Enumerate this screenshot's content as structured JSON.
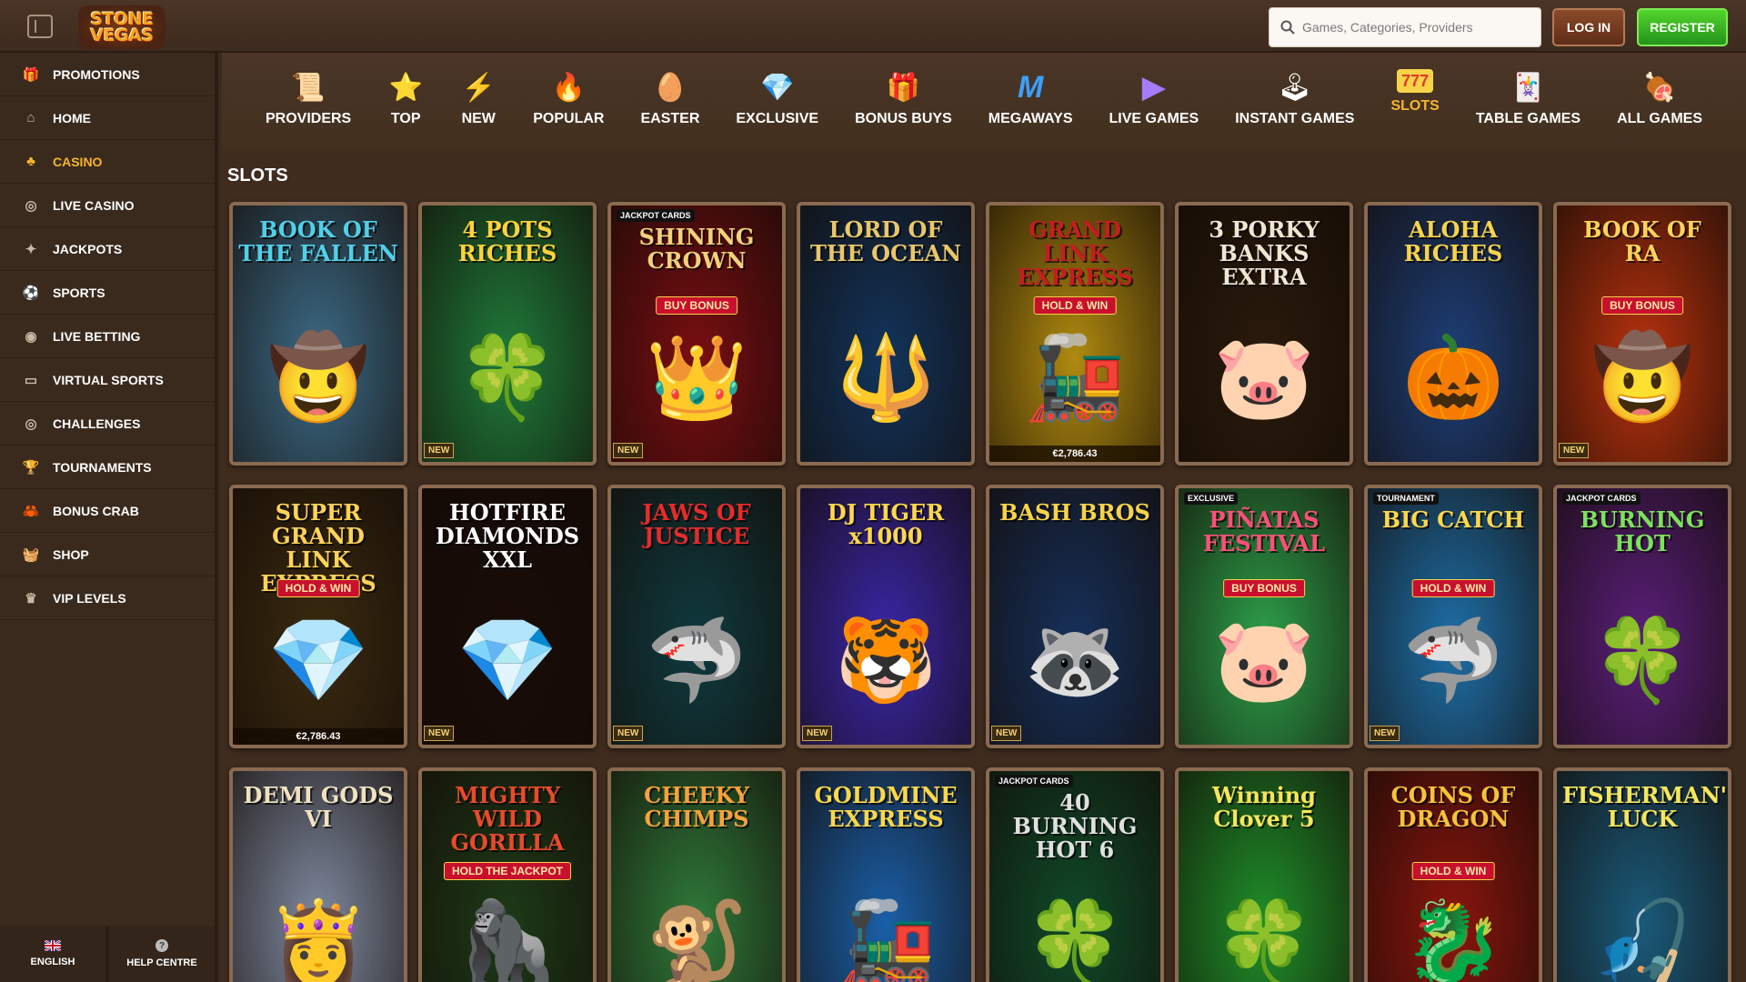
{
  "header": {
    "logo_line1": "STONE",
    "logo_line2": "VEGAS",
    "search_placeholder": "Games, Categories, Providers",
    "login_label": "LOG IN",
    "register_label": "REGISTER"
  },
  "sidebar": {
    "items": [
      {
        "label": "PROMOTIONS",
        "icon": "gift-box-icon"
      },
      {
        "label": "HOME",
        "icon": "home-icon"
      },
      {
        "label": "CASINO",
        "icon": "casino-icon",
        "active": true
      },
      {
        "label": "LIVE CASINO",
        "icon": "chip-icon"
      },
      {
        "label": "JACKPOTS",
        "icon": "jackpot-icon"
      },
      {
        "label": "SPORTS",
        "icon": "ball-icon"
      },
      {
        "label": "LIVE BETTING",
        "icon": "live-betting-icon"
      },
      {
        "label": "VIRTUAL SPORTS",
        "icon": "monitor-icon"
      },
      {
        "label": "CHALLENGES",
        "icon": "target-icon"
      },
      {
        "label": "TOURNAMENTS",
        "icon": "trophy-icon"
      },
      {
        "label": "BONUS CRAB",
        "icon": "crab-icon"
      },
      {
        "label": "SHOP",
        "icon": "basket-icon"
      },
      {
        "label": "VIP LEVELS",
        "icon": "crown-icon"
      }
    ],
    "language_label": "ENGLISH",
    "help_label": "HELP CENTRE"
  },
  "categories": [
    {
      "label": "PROVIDERS",
      "icon": "scroll-icon",
      "glyph": "📜"
    },
    {
      "label": "TOP",
      "icon": "star-icon",
      "glyph": "⭐"
    },
    {
      "label": "NEW",
      "icon": "lightning-icon",
      "glyph": "⚡"
    },
    {
      "label": "POPULAR",
      "icon": "fire-icon",
      "glyph": "🔥"
    },
    {
      "label": "EASTER",
      "icon": "egg-icon",
      "glyph": "🥚"
    },
    {
      "label": "EXCLUSIVE",
      "icon": "diamond-icon",
      "glyph": "💎"
    },
    {
      "label": "BONUS BUYS",
      "icon": "gift-icon",
      "glyph": "🎁"
    },
    {
      "label": "MEGAWAYS",
      "icon": "megaways-icon",
      "glyph": "M"
    },
    {
      "label": "LIVE GAMES",
      "icon": "play-icon",
      "glyph": "▶"
    },
    {
      "label": "INSTANT GAMES",
      "icon": "joystick-icon",
      "glyph": "🕹"
    },
    {
      "label": "SLOTS",
      "icon": "slot-777-icon",
      "glyph": "777",
      "active": true
    },
    {
      "label": "TABLE GAMES",
      "icon": "cards-icon",
      "glyph": "🃏"
    },
    {
      "label": "ALL GAMES",
      "icon": "meat-icon",
      "glyph": "🍖"
    }
  ],
  "section_title": "SLOTS",
  "new_badge": "NEW",
  "games": [
    {
      "title": "BOOK OF THE FALLEN",
      "bg": "#3b6a86",
      "title_color": "#4fd0e8",
      "art": "🤠"
    },
    {
      "title": "4 POTS RICHES",
      "bg": "#1f7a3a",
      "title_color": "#ffd23a",
      "art": "🍀",
      "new": true
    },
    {
      "title": "SHINING CROWN",
      "bg": "#7a0e12",
      "title_color": "#f1d17a",
      "sub": "BUY BONUS",
      "tag": "JACKPOT CARDS",
      "art": "👑",
      "new": true
    },
    {
      "title": "LORD OF THE OCEAN",
      "bg": "#12345c",
      "title_color": "#e8c66a",
      "art": "🔱"
    },
    {
      "title": "GRAND LINK EXPRESS",
      "bg": "#b08a10",
      "title_color": "#c41e1e",
      "sub": "HOLD & WIN",
      "art": "🚂",
      "jackpot": "€2,786.43"
    },
    {
      "title": "3 PORKY BANKS EXTRA",
      "bg": "#2a1a0c",
      "title_color": "#f0e6d2",
      "art": "🐷"
    },
    {
      "title": "ALOHA RICHES",
      "bg": "#1d3f78",
      "title_color": "#f7d34a",
      "art": "🎃"
    },
    {
      "title": "BOOK OF RA",
      "bg": "#b8320e",
      "title_color": "#ffd35a",
      "sub": "BUY BONUS",
      "art": "🤠",
      "new": true
    },
    {
      "title": "SUPER GRAND LINK EXPRESS",
      "bg": "#3a2a10",
      "title_color": "#ffd35a",
      "sub": "HOLD & WIN",
      "art": "💎",
      "jackpot": "€2,786.43"
    },
    {
      "title": "HOTFIRE DIAMONDS XXL",
      "bg": "#1a0c08",
      "title_color": "#ffffff",
      "art": "💎",
      "new": true
    },
    {
      "title": "JAWS OF JUSTICE",
      "bg": "#0f3a3f",
      "title_color": "#e82a2a",
      "art": "🦈",
      "new": true
    },
    {
      "title": "DJ TIGER x1000",
      "bg": "#3a27a8",
      "title_color": "#ffd84a",
      "art": "🐯",
      "new": true
    },
    {
      "title": "BASH BROS",
      "bg": "#16305a",
      "title_color": "#f7d34a",
      "art": "🦝",
      "new": true
    },
    {
      "title": "PIÑATAS FESTIVAL",
      "bg": "#2da04a",
      "title_color": "#ff4f7a",
      "sub": "BUY BONUS",
      "tag": "EXCLUSIVE",
      "art": "🐷"
    },
    {
      "title": "BIG CATCH",
      "bg": "#1e6fa8",
      "title_color": "#ffd84a",
      "sub": "HOLD & WIN",
      "tag": "TOURNAMENT",
      "art": "🦈",
      "new": true
    },
    {
      "title": "BURNING HOT",
      "bg": "#5a1f7a",
      "title_color": "#7be35a",
      "tag": "JACKPOT CARDS",
      "art": "🍀"
    },
    {
      "title": "DEMI GODS VI",
      "bg": "#7f8aa0",
      "title_color": "#f0e2c0",
      "art": "👸"
    },
    {
      "title": "MIGHTY WILD GORILLA",
      "bg": "#1d3a18",
      "title_color": "#e84a2a",
      "sub": "HOLD THE JACKPOT",
      "art": "🦍"
    },
    {
      "title": "CHEEKY CHIMPS",
      "bg": "#2f7a3a",
      "title_color": "#f7a23a",
      "art": "🐒"
    },
    {
      "title": "GOLDMINE EXPRESS",
      "bg": "#1a5fa8",
      "title_color": "#ffd84a",
      "art": "🚂"
    },
    {
      "title": "40 BURNING HOT 6",
      "bg": "#0f4a2a",
      "title_color": "#e0e0e0",
      "tag": "JACKPOT CARDS",
      "art": "🍀"
    },
    {
      "title": "Winning Clover 5",
      "bg": "#1f8f2a",
      "title_color": "#f7e65a",
      "art": "🍀"
    },
    {
      "title": "COINS OF DRAGON",
      "bg": "#8a160e",
      "title_color": "#f7c23a",
      "sub": "HOLD & WIN",
      "art": "🐉"
    },
    {
      "title": "FISHERMAN'S LUCK",
      "bg": "#1a5a7a",
      "title_color": "#f7e65a",
      "art": "🎣"
    }
  ]
}
